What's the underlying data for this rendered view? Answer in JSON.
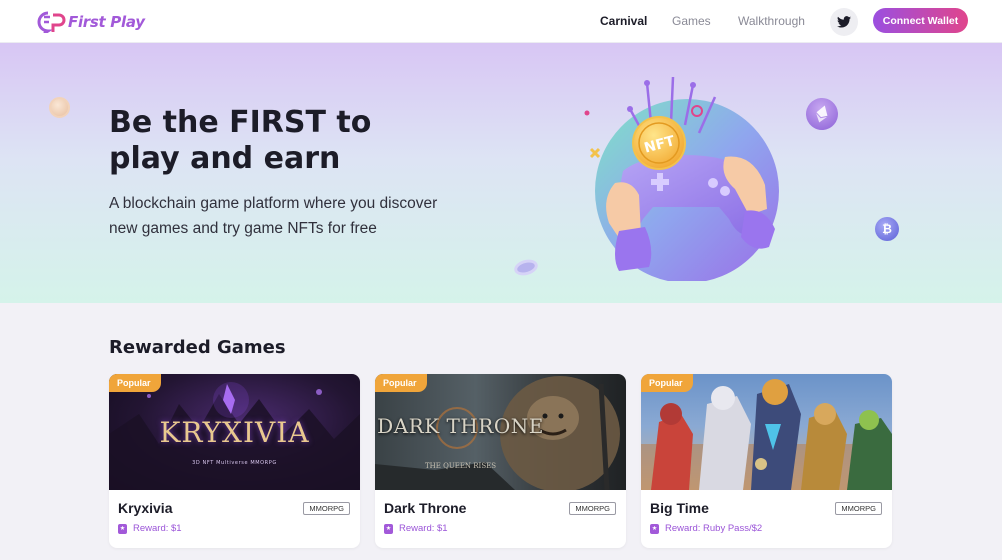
{
  "nav": {
    "logo_text": "First Play",
    "links": [
      {
        "label": "Carnival",
        "active": true
      },
      {
        "label": "Games",
        "active": false
      },
      {
        "label": "Walkthrough",
        "active": false
      }
    ],
    "wallet_label": "Connect Wallet",
    "twitter_icon": "twitter-icon"
  },
  "hero": {
    "title_line1": "Be the FIRST to",
    "title_line2": "play and earn",
    "subtitle_line1": "A blockchain game platform where you discover",
    "subtitle_line2": "new games and try game NFTs for free",
    "coin_label": "NFT",
    "btc_symbol": "₿"
  },
  "rewarded": {
    "title": "Rewarded Games",
    "cards": [
      {
        "badge": "Popular",
        "title": "Kryxivia",
        "genre": "MMORPG",
        "reward": "Reward: $1",
        "art_title": "KRYXIVIA",
        "art_sub": "3D NFT Multiverse MMORPG"
      },
      {
        "badge": "Popular",
        "title": "Dark Throne",
        "genre": "MMORPG",
        "reward": "Reward: $1",
        "art_title": "DARK THRONE",
        "art_sub": "THE QUEEN RISES"
      },
      {
        "badge": "Popular",
        "title": "Big Time",
        "genre": "MMORPG",
        "reward": "Reward: Ruby Pass/$2"
      }
    ]
  },
  "colors": {
    "accent": "#a259d9",
    "wallet_gradient_start": "#9b4fe0",
    "wallet_gradient_end": "#e0458c",
    "badge": "#f0a53a"
  }
}
